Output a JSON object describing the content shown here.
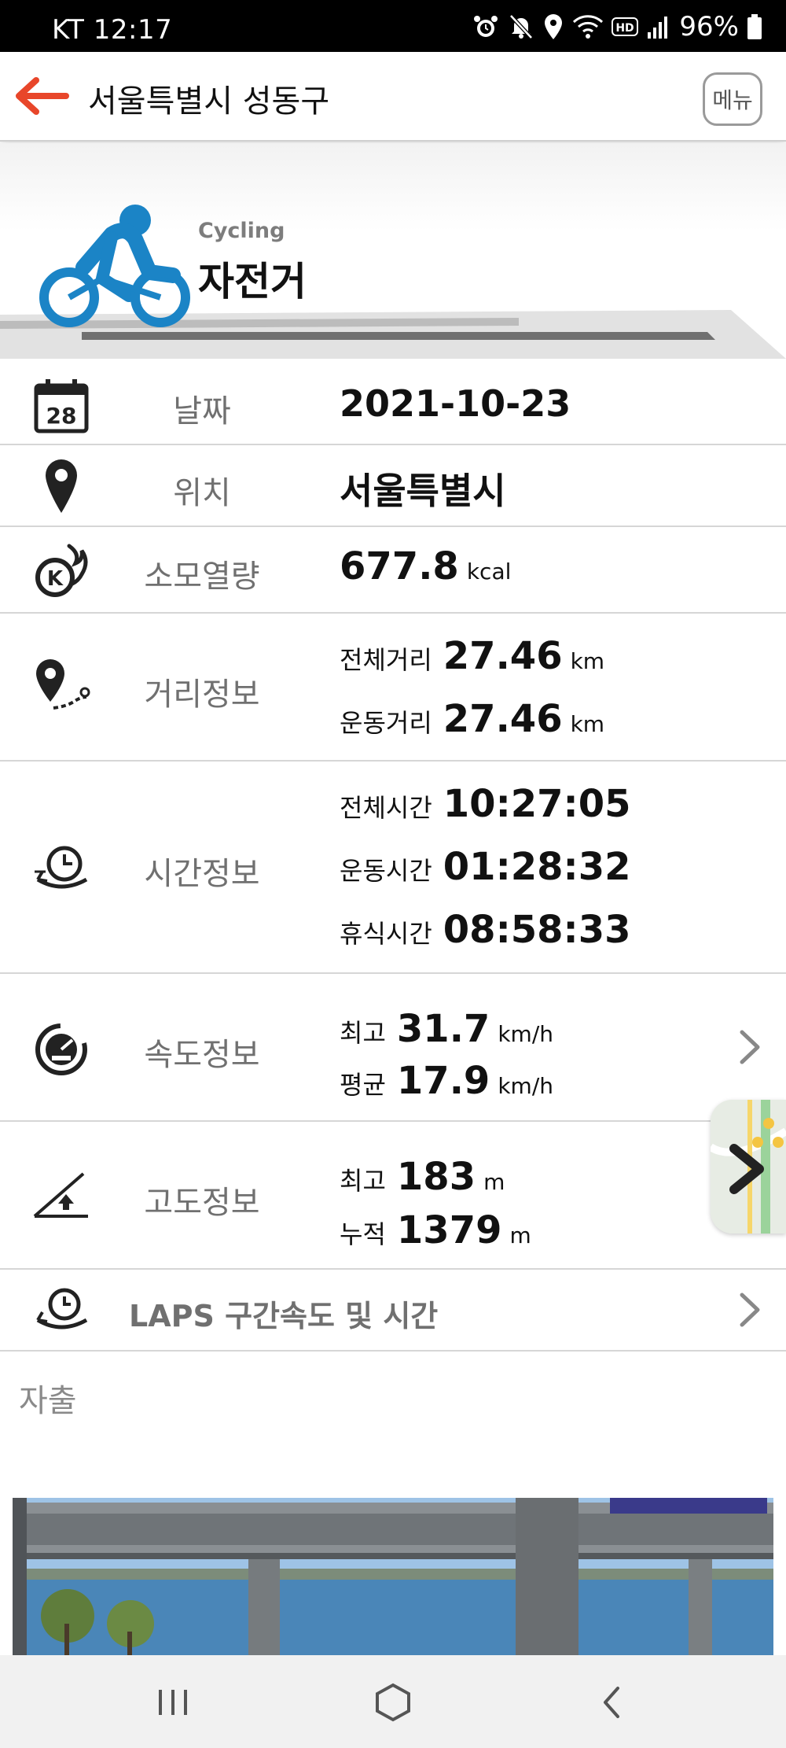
{
  "status_bar": {
    "carrier_time": "KT 12:17",
    "battery": "96%"
  },
  "app_bar": {
    "title": "서울특별시 성동구",
    "menu_label": "메뉴"
  },
  "activity": {
    "subtitle": "Cycling",
    "title": "자전거"
  },
  "rows": {
    "date": {
      "label": "날짜",
      "value": "2021-10-23",
      "icon": "calendar-icon",
      "icon_day": "28"
    },
    "location": {
      "label": "위치",
      "value": "서울특별시",
      "icon": "location-pin-icon"
    },
    "calories": {
      "label": "소모열량",
      "value": "677.8",
      "unit": "kcal",
      "icon": "calorie-icon",
      "icon_letter": "K"
    },
    "distance": {
      "label": "거리정보",
      "icon": "route-icon",
      "total_label": "전체거리",
      "total_value": "27.46",
      "total_unit": "km",
      "exercise_label": "운동거리",
      "exercise_value": "27.46",
      "exercise_unit": "km"
    },
    "time": {
      "label": "시간정보",
      "icon": "stopwatch-icon",
      "total_label": "전체시간",
      "total_value": "10:27:05",
      "exercise_label": "운동시간",
      "exercise_value": "01:28:32",
      "rest_label": "휴식시간",
      "rest_value": "08:58:33"
    },
    "speed": {
      "label": "속도정보",
      "icon": "speedometer-icon",
      "max_label": "최고",
      "max_value": "31.7",
      "max_unit": "km/h",
      "avg_label": "평균",
      "avg_value": "17.9",
      "avg_unit": "km/h"
    },
    "altitude": {
      "label": "고도정보",
      "icon": "altitude-icon",
      "max_label": "최고",
      "max_value": "183",
      "max_unit": "m",
      "cum_label": "누적",
      "cum_value": "1379",
      "cum_unit": "m"
    },
    "laps": {
      "label": "LAPS 구간속도 및 시간",
      "icon": "laps-icon"
    }
  },
  "memo": "자출",
  "colors": {
    "accent_orange": "#e8462a",
    "cyclist_blue": "#1b84c6",
    "label_gray": "#707070"
  }
}
